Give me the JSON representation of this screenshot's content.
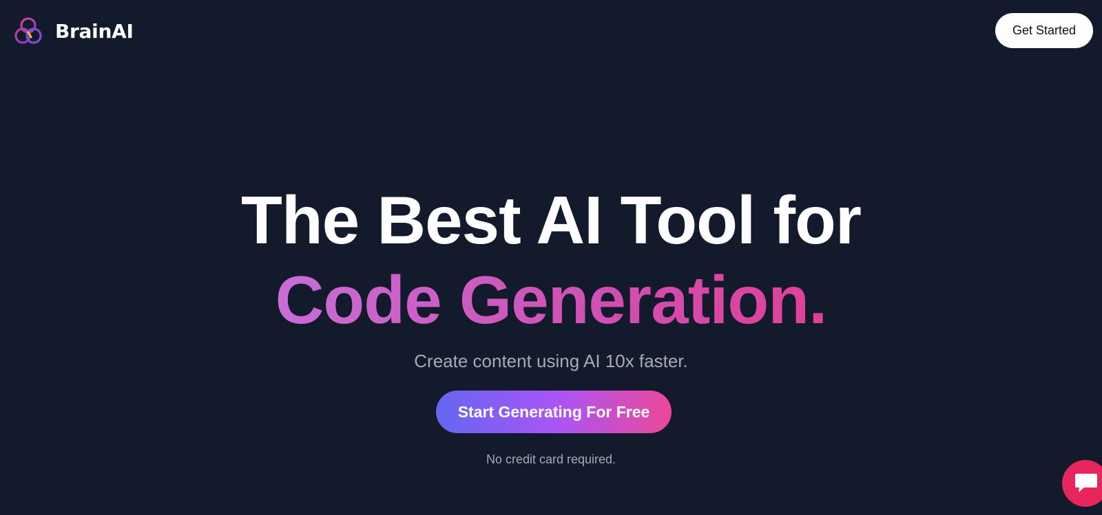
{
  "header": {
    "brand_name": "BrainAI",
    "cta_label": "Get Started"
  },
  "hero": {
    "title_line1": "The Best AI Tool for",
    "title_line2": "Code Generation.",
    "subtitle": "Create content using AI 10x faster.",
    "cta_label": "Start Generating For Free",
    "note": "No credit card required."
  },
  "chat_widget": {
    "icon": "chat-bubble-icon"
  },
  "colors": {
    "background": "#131a2b",
    "gradient_start": "#6466f1",
    "gradient_mid": "#a855f7",
    "gradient_end": "#ec4899",
    "title_gradient_start": "#c86dd7",
    "title_gradient_end": "#e04097",
    "chat_widget": "#e8265e",
    "muted_text": "#a7abb6"
  }
}
